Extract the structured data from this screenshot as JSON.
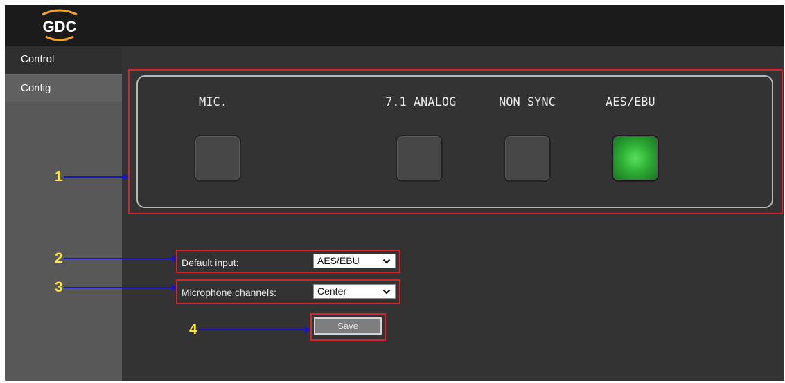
{
  "header": {
    "logo_text": "GDC"
  },
  "sidebar": {
    "items": [
      {
        "label": "Control"
      },
      {
        "label": "Config"
      }
    ]
  },
  "inputs": [
    {
      "label": "MIC.",
      "active": false
    },
    {
      "label": "7.1 ANALOG",
      "active": false
    },
    {
      "label": "NON SYNC",
      "active": false
    },
    {
      "label": "AES/EBU",
      "active": true
    }
  ],
  "form": {
    "default_input": {
      "label": "Default input:",
      "value": "AES/EBU"
    },
    "microphone_channels": {
      "label": "Microphone channels:",
      "value": "Center"
    },
    "save_label": "Save"
  },
  "callouts": [
    "1",
    "2",
    "3",
    "4"
  ],
  "colors": {
    "highlight": "#d9222a",
    "callout_number": "#ffe43a",
    "arrow": "#1515c8",
    "active_input": "#2fae36"
  }
}
